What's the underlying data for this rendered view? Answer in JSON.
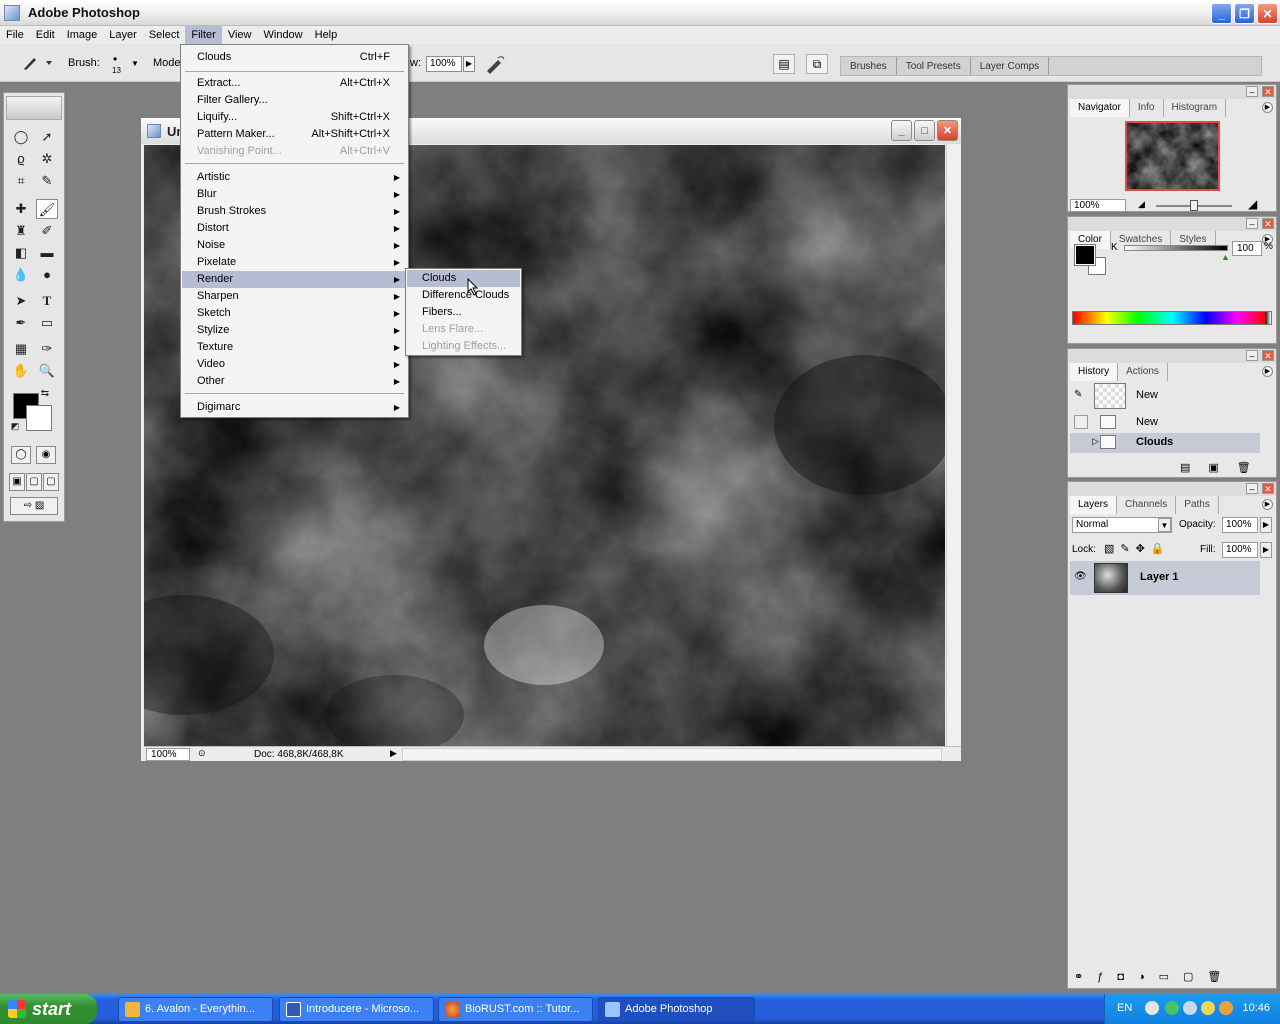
{
  "window": {
    "title": "Adobe Photoshop"
  },
  "menubar": [
    "File",
    "Edit",
    "Image",
    "Layer",
    "Select",
    "Filter",
    "View",
    "Window",
    "Help"
  ],
  "options": {
    "brush_label": "Brush:",
    "brush_size": "13",
    "mode_label": "Mode",
    "flow_label_suffix": "w:",
    "flow_value": "100%"
  },
  "palette_well": [
    "Brushes",
    "Tool Presets",
    "Layer Comps"
  ],
  "document": {
    "title": "Un",
    "zoom": "100%",
    "doc_info": "Doc: 468,8K/468,8K"
  },
  "filter_menu": {
    "last_filter": {
      "label": "Clouds",
      "shortcut": "Ctrl+F"
    },
    "group1": [
      {
        "label": "Extract...",
        "shortcut": "Alt+Ctrl+X"
      },
      {
        "label": "Filter Gallery...",
        "shortcut": ""
      },
      {
        "label": "Liquify...",
        "shortcut": "Shift+Ctrl+X"
      },
      {
        "label": "Pattern Maker...",
        "shortcut": "Alt+Shift+Ctrl+X"
      },
      {
        "label": "Vanishing Point...",
        "shortcut": "Alt+Ctrl+V",
        "disabled": true
      }
    ],
    "submenus": [
      "Artistic",
      "Blur",
      "Brush Strokes",
      "Distort",
      "Noise",
      "Pixelate",
      "Render",
      "Sharpen",
      "Sketch",
      "Stylize",
      "Texture",
      "Video",
      "Other"
    ],
    "last": "Digimarc"
  },
  "render_submenu": [
    {
      "label": "Clouds",
      "highlighted": true
    },
    {
      "label": "Difference Clouds"
    },
    {
      "label": "Fibers..."
    },
    {
      "label": "Lens Flare...",
      "disabled": true
    },
    {
      "label": "Lighting Effects...",
      "disabled": true
    }
  ],
  "navigator": {
    "tabs": [
      "Navigator",
      "Info",
      "Histogram"
    ],
    "zoom": "100%"
  },
  "color": {
    "tabs": [
      "Color",
      "Swatches",
      "Styles"
    ],
    "channel": "K",
    "value": "100",
    "unit": "%"
  },
  "history": {
    "tabs": [
      "History",
      "Actions"
    ],
    "snapshot": "New",
    "states": [
      "New",
      "Clouds"
    ]
  },
  "layers": {
    "tabs": [
      "Layers",
      "Channels",
      "Paths"
    ],
    "blend_mode": "Normal",
    "opacity_label": "Opacity:",
    "opacity": "100%",
    "lock_label": "Lock:",
    "fill_label": "Fill:",
    "fill": "100%",
    "layer_name": "Layer 1"
  },
  "taskbar": {
    "start": "start",
    "items": [
      "6. Avalon - Everythin...",
      "Introducere - Microso...",
      "BioRUST.com :: Tutor...",
      "Adobe Photoshop"
    ],
    "lang": "EN",
    "clock": "10:46"
  },
  "colors": {
    "menu_highlight": "#b6bdd2",
    "taskbar": "#245edb",
    "start": "#329132"
  }
}
